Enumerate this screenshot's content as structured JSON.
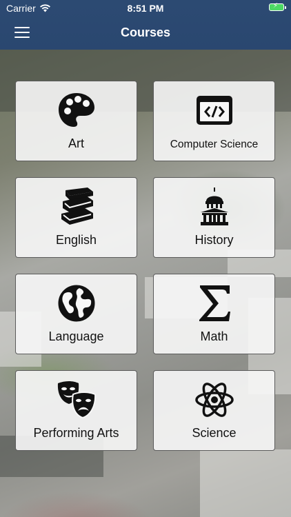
{
  "status_bar": {
    "carrier": "Carrier",
    "time": "8:51 PM"
  },
  "nav": {
    "title": "Courses",
    "menu_icon": "hamburger-menu-icon"
  },
  "colors": {
    "nav_background": "#2c4a72",
    "battery": "#4cd964",
    "tile_background": "#f7f7f7"
  },
  "courses": [
    {
      "label": "Art",
      "icon": "palette-icon"
    },
    {
      "label": "Computer Science",
      "icon": "code-window-icon"
    },
    {
      "label": "English",
      "icon": "books-icon"
    },
    {
      "label": "History",
      "icon": "capitol-building-icon"
    },
    {
      "label": "Language",
      "icon": "globe-icon"
    },
    {
      "label": "Math",
      "icon": "sigma-icon"
    },
    {
      "label": "Performing Arts",
      "icon": "theater-masks-icon"
    },
    {
      "label": "Science",
      "icon": "atom-icon"
    }
  ]
}
